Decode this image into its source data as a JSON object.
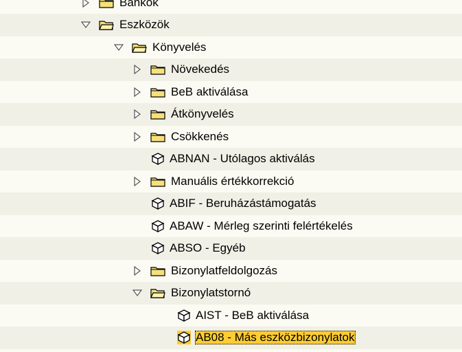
{
  "tree": [
    {
      "label": "Bankok",
      "state": "collapsed",
      "type": "folder",
      "level": 1
    },
    {
      "label": "Eszközök",
      "state": "expanded",
      "type": "folder",
      "level": 1
    },
    {
      "label": "Könyvelés",
      "state": "expanded",
      "type": "folder",
      "level": 2
    },
    {
      "label": "Növekedés",
      "state": "collapsed",
      "type": "folder",
      "level": 3
    },
    {
      "label": "BeB aktiválása",
      "state": "collapsed",
      "type": "folder",
      "level": 3
    },
    {
      "label": "Átkönyvelés",
      "state": "collapsed",
      "type": "folder",
      "level": 3
    },
    {
      "label": "Csökkenés",
      "state": "collapsed",
      "type": "folder",
      "level": 3
    },
    {
      "label": "ABNAN - Utólagos aktiválás",
      "state": "leaf",
      "type": "transaction",
      "level": 3
    },
    {
      "label": "Manuális értékkorrekció",
      "state": "collapsed",
      "type": "folder",
      "level": 3
    },
    {
      "label": "ABIF - Beruházástámogatás",
      "state": "leaf",
      "type": "transaction",
      "level": 3
    },
    {
      "label": "ABAW - Mérleg szerinti felértékelés",
      "state": "leaf",
      "type": "transaction",
      "level": 3
    },
    {
      "label": "ABSO - Egyéb",
      "state": "leaf",
      "type": "transaction",
      "level": 3
    },
    {
      "label": "Bizonylatfeldolgozás",
      "state": "collapsed",
      "type": "folder",
      "level": 3
    },
    {
      "label": "Bizonylatstornó",
      "state": "expanded",
      "type": "folder",
      "level": 3
    },
    {
      "label": "AIST - BeB aktiválása",
      "state": "leaf",
      "type": "transaction",
      "level": 4
    },
    {
      "label": "AB08 - Más eszközbizonylatok",
      "state": "leaf",
      "type": "transaction",
      "level": 4,
      "selected": true
    }
  ],
  "colors": {
    "background": "#fbfbf3",
    "band": "#f1f0e6",
    "selection": "#ffcc33",
    "folder_fill": "#f5e07a",
    "folder_border": "#000000",
    "arrow_fill": "#ffffff"
  },
  "icons": {
    "folder": "folder-icon",
    "open_folder": "open-folder-icon",
    "transaction": "transaction-cube-icon",
    "collapsed": "expand-arrow-icon",
    "expanded": "collapse-arrow-icon"
  }
}
